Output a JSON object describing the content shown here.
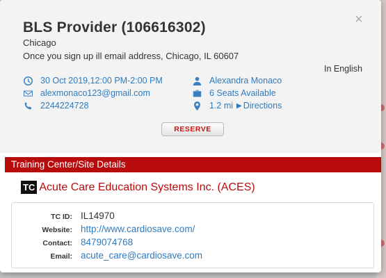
{
  "modal": {
    "close_glyph": "×",
    "title": "BLS Provider (106616302)",
    "city": "Chicago",
    "address": "Once you sign up ill email address, Chicago, IL 60607",
    "language": "In English",
    "info": {
      "datetime": "30 Oct 2019,12:00 PM-2:00 PM",
      "email": "alexmonaco123@gmail.com",
      "phone": "2244224728",
      "instructor": "Alexandra Monaco",
      "seats": "6 Seats Available",
      "distance": "1.2 mi",
      "directions_arrow": "▶",
      "directions": "Directions"
    },
    "reserve_label": "RESERVE"
  },
  "training_center": {
    "section_title": "Training Center/Site Details",
    "logo_text": "TC",
    "name": "Acute Care Education Systems Inc. (ACES)",
    "details": {
      "tc_id_label": "TC ID:",
      "tc_id": "IL14970",
      "website_label": "Website:",
      "website": "http://www.cardiosave.com/",
      "contact_label": "Contact:",
      "contact": "8479074768",
      "email_label": "Email:",
      "email": "acute_care@cardiosave.com"
    }
  },
  "colors": {
    "accent_red": "#b80c0c",
    "link_blue": "#2f7bbf",
    "icon_blue": "#3a7fc0"
  }
}
